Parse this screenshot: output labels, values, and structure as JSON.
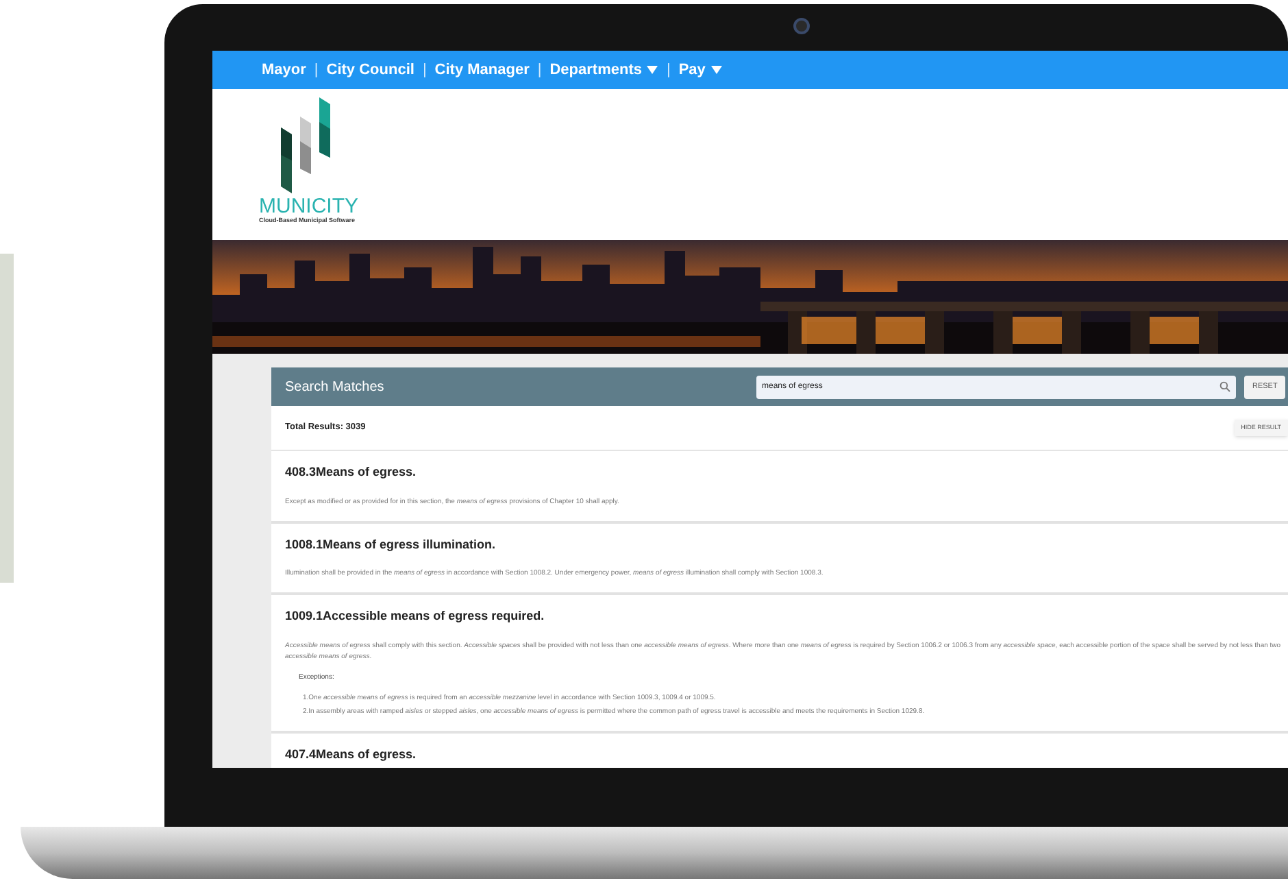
{
  "nav": {
    "separator": "|",
    "items": [
      {
        "label": "Mayor",
        "dropdown": false
      },
      {
        "label": "City Council",
        "dropdown": false
      },
      {
        "label": "City Manager",
        "dropdown": false
      },
      {
        "label": "Departments",
        "dropdown": true
      },
      {
        "label": "Pay",
        "dropdown": true
      }
    ]
  },
  "logo": {
    "name": "MUNICITY",
    "tagline": "Cloud-Based Municipal Software"
  },
  "results": {
    "title": "Search Matches",
    "search_value": "means of egress",
    "reset_label": "RESET",
    "total": "Total Results: 3039",
    "hide_label": "HIDE RESULT",
    "items": [
      {
        "title": "408.3Means of egress.",
        "text": "Except as modified or as provided for in this section, the *means of egress* provisions of Chapter 10 shall apply."
      },
      {
        "title": "1008.1Means of egress illumination.",
        "text": "Illumination shall be provided in the *means of egress* in accordance with Section 1008.2. Under emergency power, *means of egress* illumination shall comply with Section 1008.3."
      },
      {
        "title": "1009.1Accessible means of egress required.",
        "text": "*Accessible means of egress* shall comply with this section. *Accessible spaces* shall be provided with not less than one *accessible means of egress*. Where more than one *means of egress* is required by Section 1006.2 or 1006.3 from any *accessible space*, each accessible portion of the space shall be served by not less than two *accessible means of egress*.",
        "exceptions_label": "Exceptions:",
        "exceptions": [
          "1.One *accessible means of egress* is required from an *accessible mezzanine* level in accordance with Section 1009.3, 1009.4 or 1009.5.",
          "2.In assembly areas with ramped *aisles* or stepped *aisles*, one *accessible means of egress* is permitted where the common path of egress travel is accessible and meets the requirements in Section 1029.8."
        ]
      },
      {
        "title": "407.4Means of egress."
      }
    ]
  }
}
